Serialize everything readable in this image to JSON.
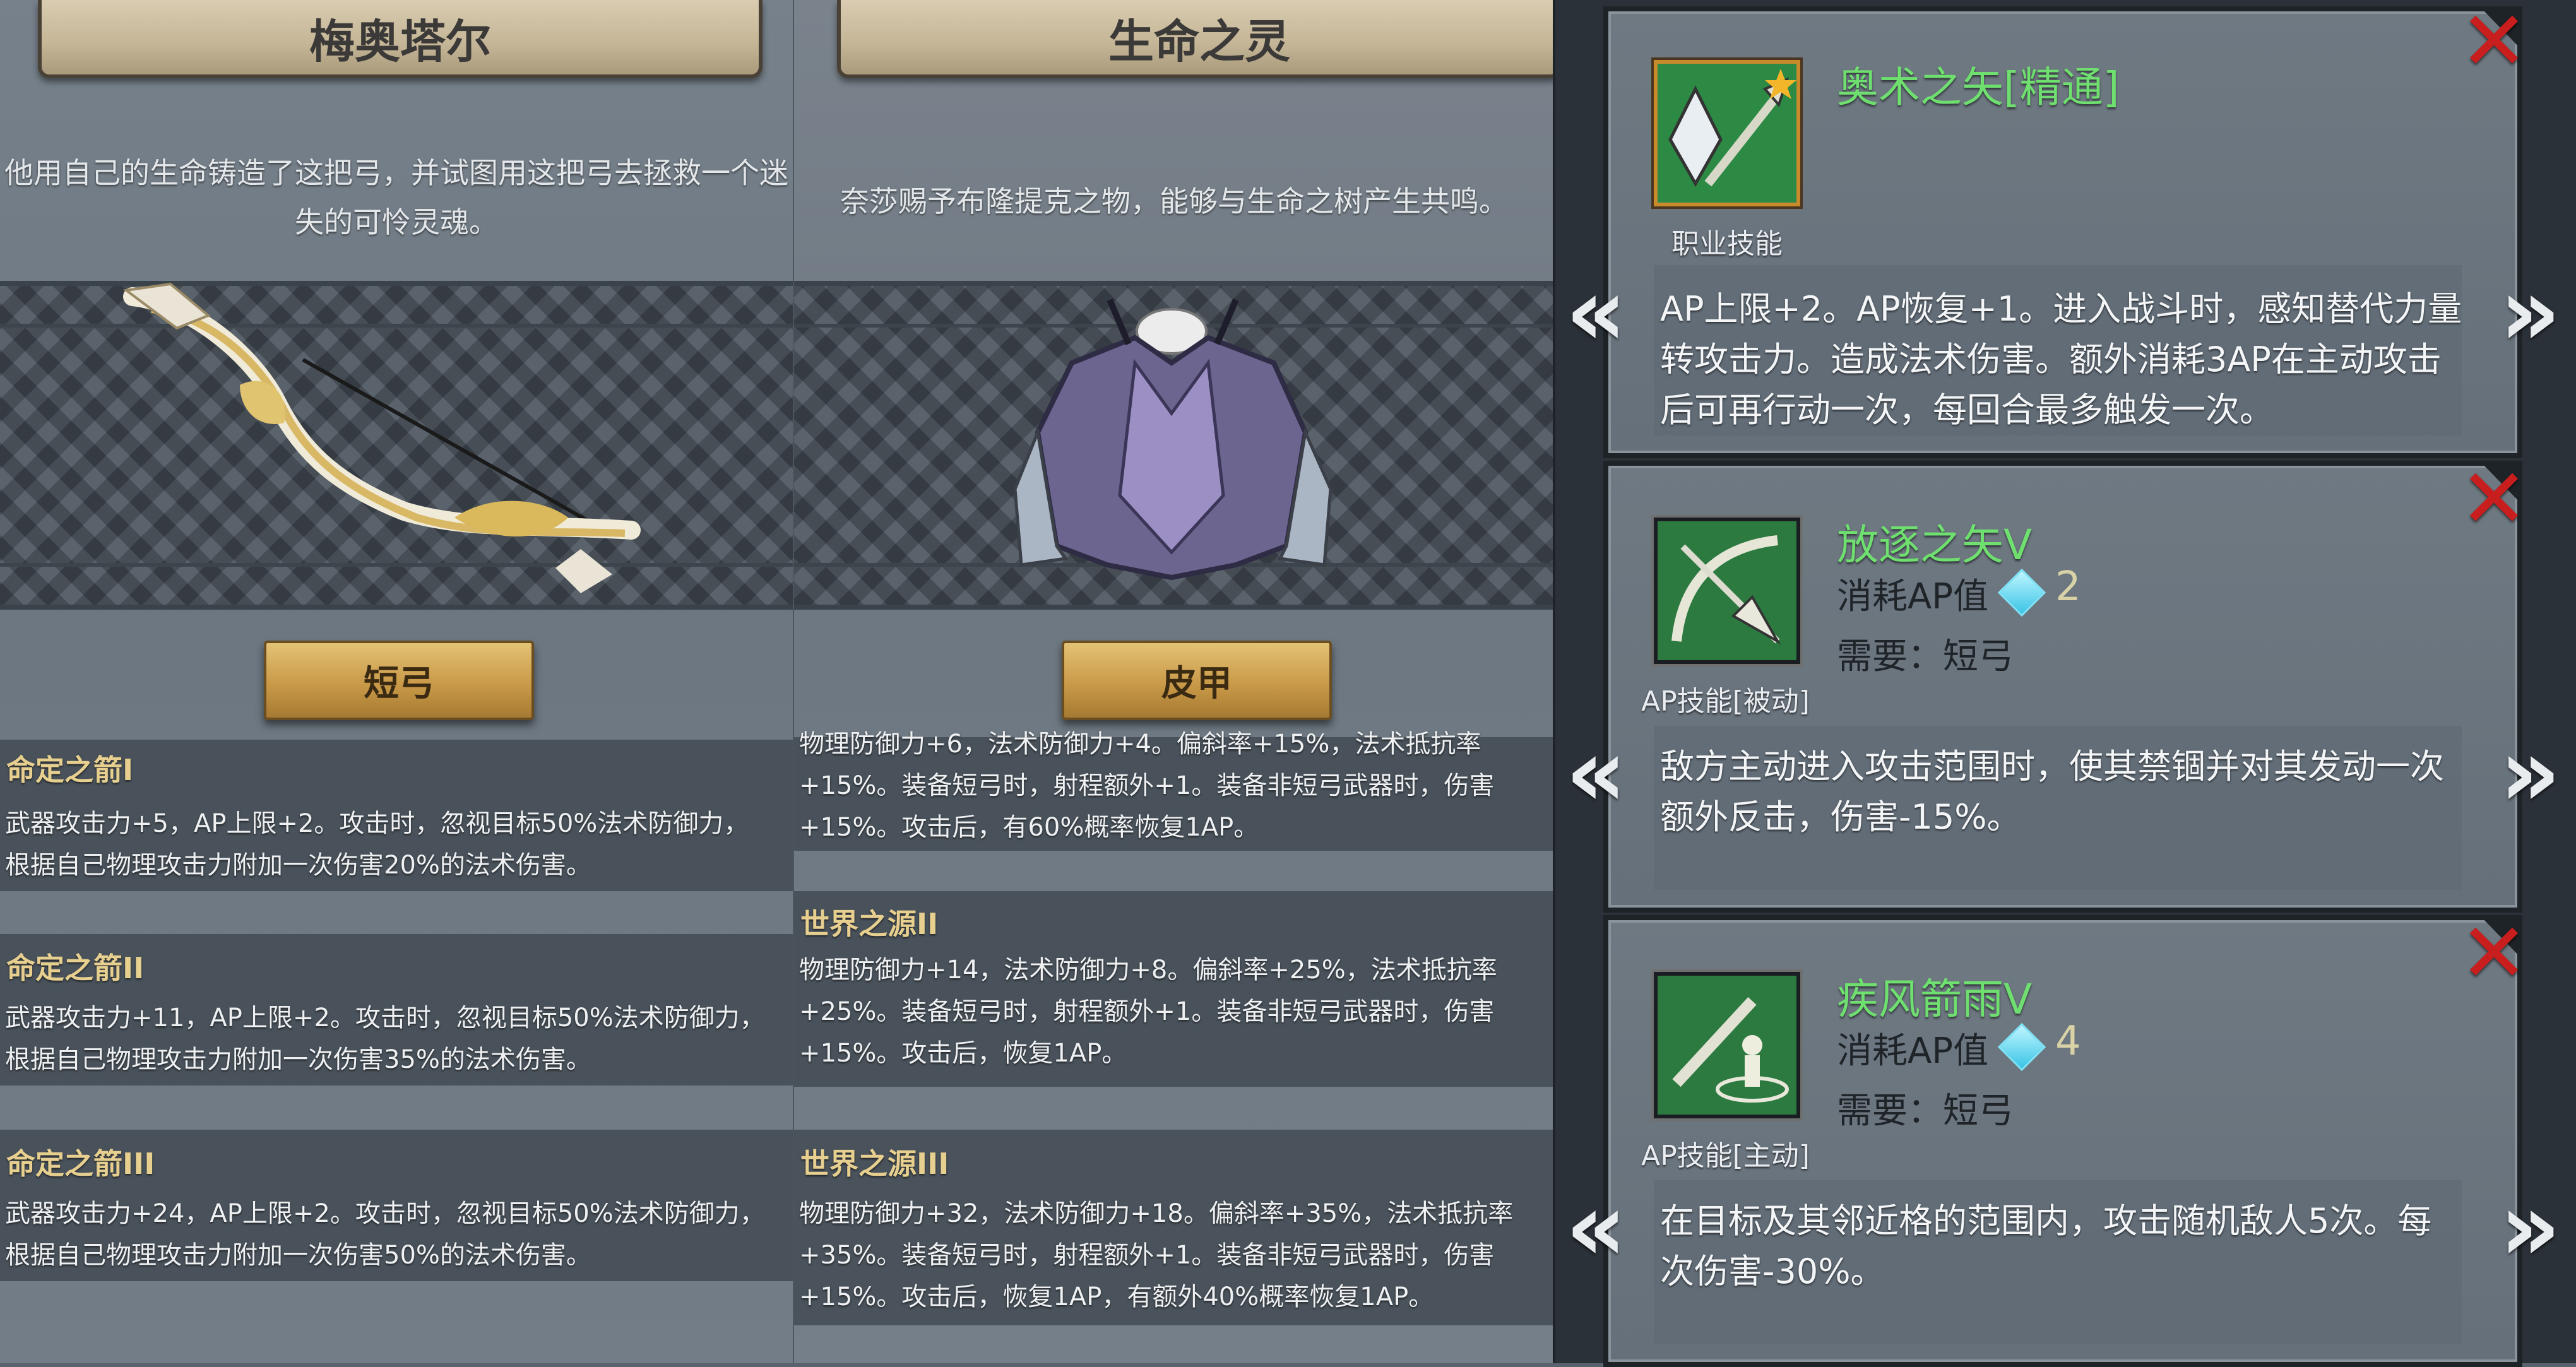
{
  "items": [
    {
      "name": "梅奥塔尔",
      "description": [
        "他用自己的生命铸造了这把弓，并试图用这把弓去拯救一个迷",
        "失的可怜灵魂。"
      ],
      "type_label": "短弓",
      "levels": [
        {
          "title": "命定之箭I",
          "lines": [
            "武器攻击力+5，AP上限+2。攻击时，忽视目标50%法术防御力，",
            "根据自己物理攻击力附加一次伤害20%的法术伤害。"
          ]
        },
        {
          "title": "命定之箭II",
          "lines": [
            "武器攻击力+11，AP上限+2。攻击时，忽视目标50%法术防御力，",
            "根据自己物理攻击力附加一次伤害35%的法术伤害。"
          ]
        },
        {
          "title": "命定之箭III",
          "lines": [
            "武器攻击力+24，AP上限+2。攻击时，忽视目标50%法术防御力，",
            "根据自己物理攻击力附加一次伤害50%的法术伤害。"
          ]
        }
      ]
    },
    {
      "name": "生命之灵",
      "description": [
        "奈莎赐予布隆提克之物，能够与生命之树产生共鸣。"
      ],
      "type_label": "皮甲",
      "partial_lines": [
        "物理防御力+6，法术防御力+4。偏斜率+15%，法术抵抗率",
        "+15%。装备短弓时，射程额外+1。装备非短弓武器时，伤害",
        "+15%。攻击后，有60%概率恢复1AP。"
      ],
      "levels": [
        {
          "title": "世界之源II",
          "lines": [
            "物理防御力+14，法术防御力+8。偏斜率+25%，法术抵抗率",
            "+25%。装备短弓时，射程额外+1。装备非短弓武器时，伤害",
            "+15%。攻击后，恢复1AP。"
          ]
        },
        {
          "title": "世界之源III",
          "lines": [
            "物理防御力+32，法术防御力+18。偏斜率+35%，法术抵抗率",
            "+35%。装备短弓时，射程额外+1。装备非短弓武器时，伤害",
            "+15%。攻击后，恢复1AP，有额外40%概率恢复1AP。"
          ]
        }
      ]
    }
  ],
  "skills": [
    {
      "name": "奥术之矢[精通]",
      "kind": "职业技能",
      "icon": "arcane-arrow-icon",
      "description": [
        "AP上限+2。AP恢复+1。进入战斗时，感知替代力量",
        "转攻击力。造成法术伤害。额外消耗3AP在主动攻击",
        "后可再行动一次，每回合最多触发一次。"
      ]
    },
    {
      "name": "放逐之矢V",
      "kind": "AP技能[被动]",
      "icon": "banish-arrow-icon",
      "cost_label": "消耗AP值",
      "cost": "2",
      "requirement": "需要：短弓",
      "description": [
        "敌方主动进入攻击范围时，使其禁锢并对其发动一次",
        "额外反击，伤害-15%。"
      ]
    },
    {
      "name": "疾风箭雨V",
      "kind": "AP技能[主动]",
      "icon": "arrow-rain-icon",
      "cost_label": "消耗AP值",
      "cost": "4",
      "requirement": "需要：短弓",
      "description": [
        "在目标及其邻近格的范围内，攻击随机敌人5次。每",
        "次伤害-30%。"
      ]
    }
  ],
  "glyphs": {
    "close": "✕",
    "prev": "«",
    "next": "»"
  },
  "colors": {
    "skill_name": "#6fe06f",
    "level_title": "#e7cf8f",
    "close": "#c81e1e"
  }
}
